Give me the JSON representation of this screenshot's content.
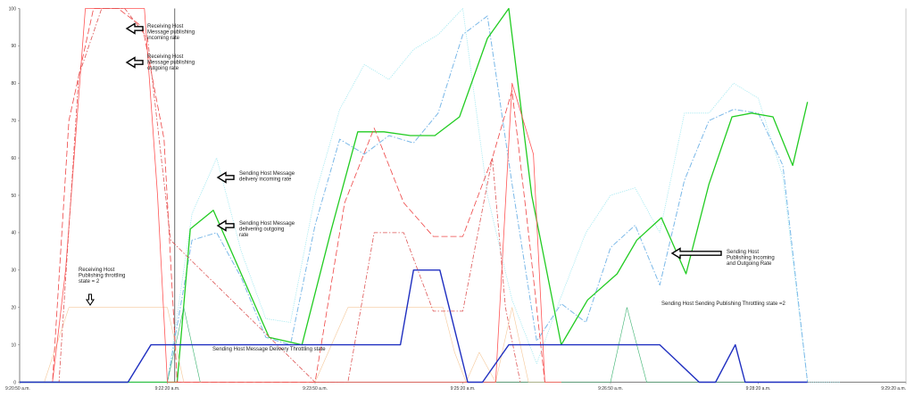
{
  "chart_data": {
    "type": "line",
    "title": "",
    "xlabel": "",
    "ylabel": "",
    "ylim": [
      0,
      100
    ],
    "y_ticks": [
      "0",
      "10",
      "20",
      "30",
      "40",
      "50",
      "60",
      "70",
      "80",
      "90",
      "100"
    ],
    "x_range_seconds": [
      0,
      540
    ],
    "x_ticks": [
      {
        "t": 0,
        "label": "9:20:50 a.m."
      },
      {
        "t": 90,
        "label": "9:22:20 a.m."
      },
      {
        "t": 180,
        "label": "9:23:50 a.m."
      },
      {
        "t": 270,
        "label": "9:25:20 a.m."
      },
      {
        "t": 360,
        "label": "9:26:50 a.m."
      },
      {
        "t": 450,
        "label": "9:28:20 a.m."
      },
      {
        "t": 540,
        "label": "9:29:20 a.m."
      }
    ],
    "grid": false,
    "colors": {
      "axis": "#808080",
      "tick_text": "#333333",
      "cursor_line": "#444444"
    },
    "series": [
      {
        "color": "#9fe8f0",
        "dash": "1.2,1.2",
        "width": 0.8,
        "x": [
          0,
          80,
          90,
          105,
          120,
          135,
          150,
          165,
          180,
          195,
          210,
          225,
          240,
          255,
          270,
          285,
          300,
          315,
          330,
          345,
          360,
          375,
          390,
          405,
          420,
          435,
          450,
          465,
          480,
          495,
          500
        ],
        "y": [
          0,
          0,
          0,
          45,
          60,
          35,
          17,
          16,
          50,
          73,
          85,
          81,
          89,
          93,
          100,
          50,
          22,
          5,
          23,
          40,
          50,
          52,
          40,
          72,
          72,
          80,
          76,
          55,
          0,
          0,
          0
        ]
      },
      {
        "color": "#7ab8e8",
        "dash": "6,2,1.5,2",
        "width": 1.0,
        "x": [
          0,
          80,
          90,
          105,
          120,
          135,
          150,
          165,
          180,
          195,
          210,
          225,
          240,
          255,
          270,
          285,
          300,
          315,
          330,
          345,
          360,
          375,
          390,
          405,
          420,
          435,
          450,
          465,
          480
        ],
        "y": [
          0,
          0,
          0,
          38,
          40,
          28,
          12,
          10,
          42,
          65,
          61,
          66,
          64,
          72,
          93,
          98,
          53,
          11,
          21,
          16,
          36,
          42,
          26,
          54,
          70,
          73,
          72,
          58,
          0
        ]
      },
      {
        "color": "#22cc22",
        "dash": "",
        "width": 1.3,
        "x": [
          0,
          82,
          96,
          104,
          118,
          136,
          152,
          172,
          190,
          206,
          222,
          238,
          253,
          268,
          285,
          298,
          312,
          330,
          346,
          364,
          376,
          391,
          406,
          420,
          434,
          446,
          459,
          471,
          480
        ],
        "y": [
          0,
          0,
          0,
          41,
          46,
          28,
          12,
          10,
          41,
          67,
          67,
          66,
          66,
          71,
          92,
          100,
          50,
          10,
          22,
          29,
          38,
          44,
          29,
          53,
          71,
          72,
          71,
          58,
          75
        ]
      },
      {
        "color": "#3cb371",
        "dash": "",
        "width": 0.6,
        "x": [
          0,
          82,
          90,
          100,
          110,
          180,
          360,
          370,
          382,
          392,
          480
        ],
        "y": [
          0,
          0,
          0,
          20,
          0,
          0,
          0,
          20,
          0,
          0,
          0
        ]
      },
      {
        "color": "#f5c89a",
        "dash": "",
        "width": 0.6,
        "x": [
          0,
          15,
          30,
          60,
          90,
          100,
          180,
          200,
          220,
          240,
          258,
          265,
          272,
          280,
          290,
          300,
          310,
          320,
          330
        ],
        "y": [
          0,
          0,
          20,
          20,
          20,
          0,
          0,
          20,
          20,
          20,
          20,
          8,
          0,
          8,
          0,
          20,
          0,
          0,
          0
        ]
      },
      {
        "color": "#ff5555",
        "dash": "",
        "width": 0.8,
        "x": [
          0,
          20,
          28,
          40,
          60,
          76,
          84,
          90,
          240,
          290,
          300,
          313,
          320,
          330
        ],
        "y": [
          0,
          0,
          30,
          100,
          100,
          100,
          50,
          0,
          0,
          0,
          80,
          61,
          0,
          0
        ]
      },
      {
        "color": "#ee4444",
        "dash": "7,3",
        "width": 0.8,
        "x": [
          0,
          20,
          30,
          45,
          60,
          75,
          88,
          96,
          180,
          198,
          216,
          234,
          252,
          270,
          288,
          300,
          310,
          320
        ],
        "y": [
          0,
          0,
          70,
          100,
          100,
          95,
          65,
          0,
          0,
          48,
          68,
          48,
          39,
          39,
          60,
          78,
          40,
          0
        ]
      },
      {
        "color": "#dd5555",
        "dash": "5,2,1.5,2",
        "width": 0.8,
        "x": [
          0,
          24,
          36,
          50,
          64,
          78,
          92,
          180,
          200,
          216,
          234,
          252,
          270,
          288,
          296,
          305
        ],
        "y": [
          0,
          0,
          82,
          100,
          100,
          92,
          38,
          0,
          0,
          40,
          40,
          19,
          19,
          60,
          20,
          0
        ]
      },
      {
        "color": "#1f2fc0",
        "dash": "",
        "width": 1.4,
        "x": [
          0,
          66,
          80,
          120,
          180,
          232,
          240,
          256,
          273,
          282,
          298,
          326,
          362,
          390,
          414,
          424,
          436,
          442,
          450,
          480
        ],
        "y": [
          0,
          0,
          10,
          10,
          10,
          10,
          30,
          30,
          0,
          0,
          10,
          10,
          10,
          10,
          0,
          0,
          10,
          0,
          0,
          0
        ]
      }
    ],
    "annotations": [
      {
        "lines": [
          "Receiving Host",
          "Message publishing",
          "incoming rate"
        ],
        "arrow": "left"
      },
      {
        "lines": [
          "Receiving Host",
          "Message publishing",
          "outgoing rate"
        ],
        "arrow": "left"
      },
      {
        "lines": [
          "Sending Host Message",
          "delivery incoming rate"
        ],
        "arrow": "left"
      },
      {
        "lines": [
          "Sending Host Message",
          "delivering outgoing",
          "rate"
        ],
        "arrow": "left"
      },
      {
        "lines": [
          "Receiving  Host",
          "Publishing throttling",
          "state = 2"
        ],
        "arrow": "down"
      },
      {
        "lines": [
          "Sending Host Message Delivery Throttling state"
        ],
        "arrow": "none"
      },
      {
        "lines": [
          "Sending Host",
          "Publishing Incoming",
          "and Outgoing Rate"
        ],
        "arrow": "left"
      },
      {
        "lines": [
          "Sending Host Sending Publishing Throttling state =2"
        ],
        "arrow": "none"
      }
    ]
  }
}
